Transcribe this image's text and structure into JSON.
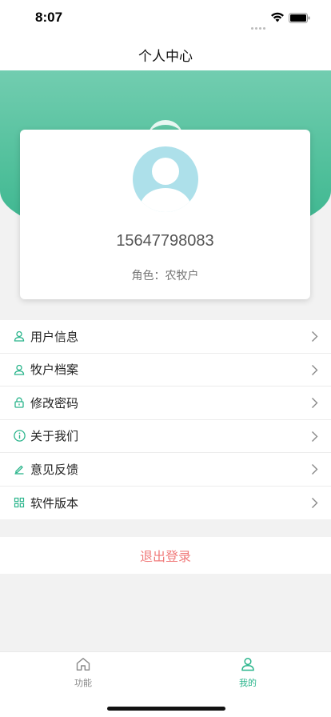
{
  "status_bar": {
    "time": "8:07"
  },
  "nav": {
    "title": "个人中心"
  },
  "profile": {
    "phone": "15647798083",
    "role": "角色：农牧户"
  },
  "menu": {
    "items": [
      {
        "label": "用户信息",
        "icon": "user-icon"
      },
      {
        "label": "牧户档案",
        "icon": "user-icon"
      },
      {
        "label": "修改密码",
        "icon": "lock-icon"
      },
      {
        "label": "关于我们",
        "icon": "info-icon"
      },
      {
        "label": "意见反馈",
        "icon": "edit-icon"
      },
      {
        "label": "软件版本",
        "icon": "grid-icon"
      }
    ]
  },
  "logout": {
    "label": "退出登录"
  },
  "tabs": [
    {
      "label": "功能",
      "icon": "home-icon"
    },
    {
      "label": "我的",
      "icon": "user-icon",
      "active": true
    }
  ],
  "colors": {
    "accent": "#2bb58c",
    "logout": "#f07b7b",
    "avatar_bg": "#ade0ea"
  }
}
